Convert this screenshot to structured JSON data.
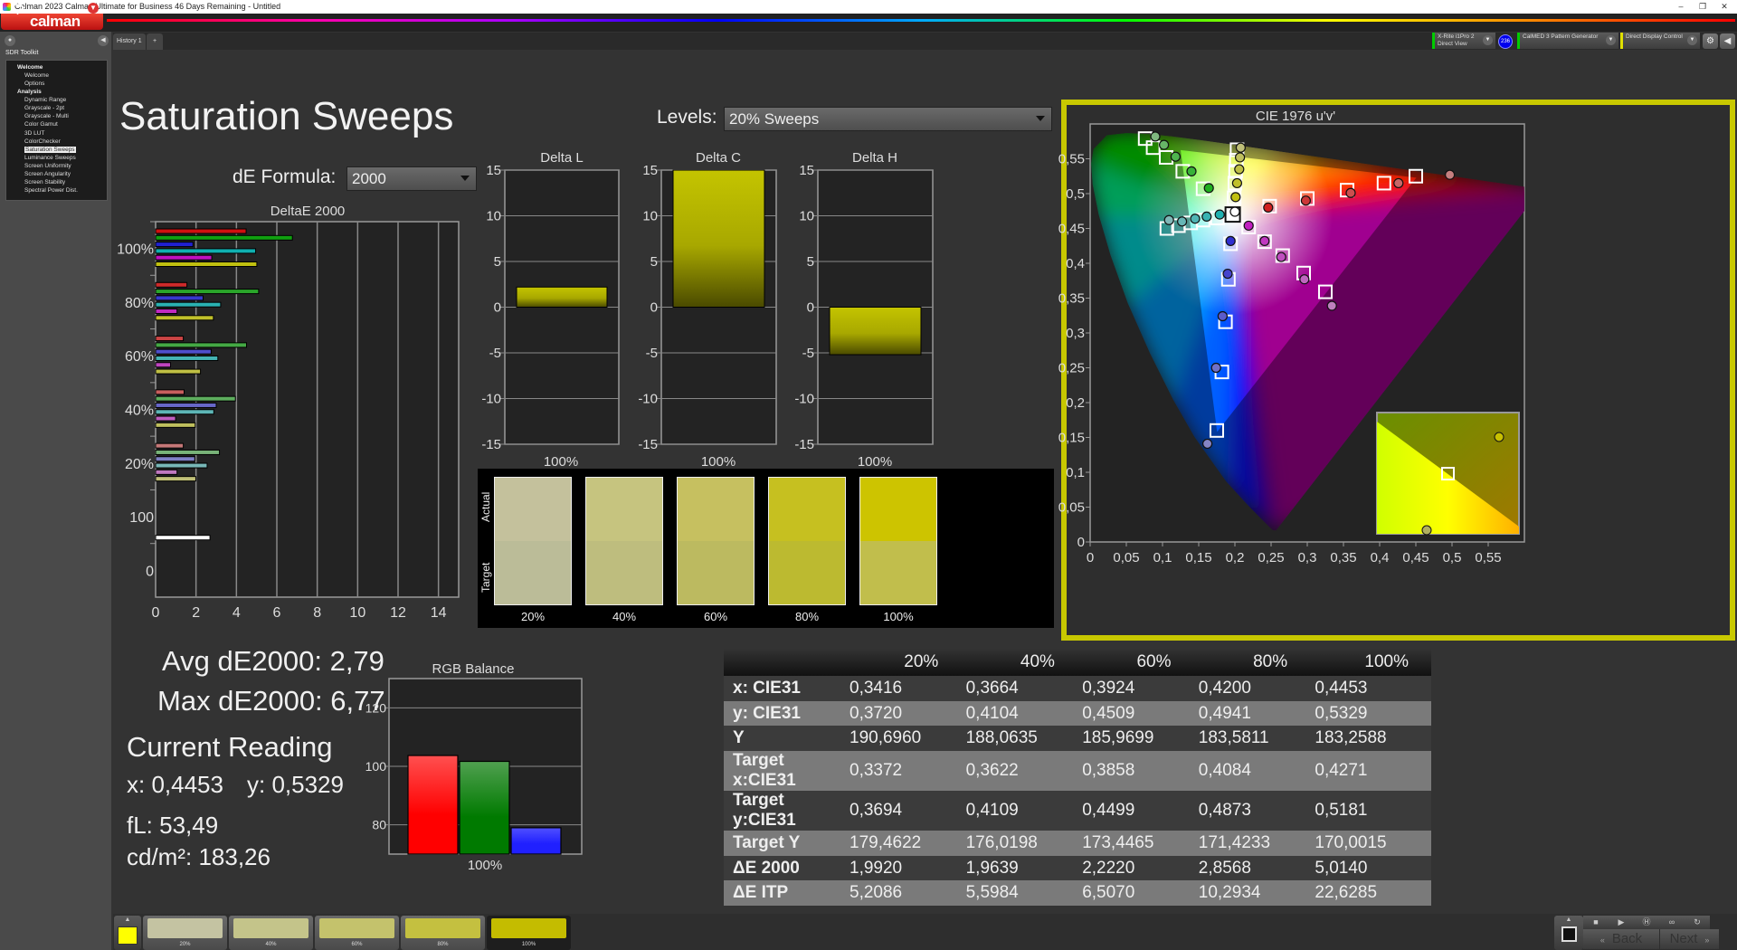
{
  "window": {
    "title": "Calman 2023 Calman Ultimate for Business 46 Days Remaining  - Untitled",
    "minimize": "–",
    "restore": "❐",
    "close": "✕"
  },
  "app": {
    "logo_text": "calman"
  },
  "sidebar": {
    "toolkit": "SDR Toolkit",
    "tree": [
      {
        "label": "Welcome",
        "children": [
          "Welcome",
          "Options"
        ]
      },
      {
        "label": "Analysis",
        "children": [
          "Dynamic Range",
          "Grayscale - 2pt",
          "Grayscale - Multi",
          "Color Gamut",
          "3D LUT",
          "ColorChecker",
          "Saturation Sweeps",
          "Luminance Sweeps",
          "Screen Uniformity",
          "Screen Angularity",
          "Screen Stability",
          "Spectral Power Dist."
        ]
      }
    ],
    "selected": "Saturation Sweeps"
  },
  "tabs": [
    {
      "label": "History 1"
    },
    {
      "label": "+"
    }
  ],
  "devices": {
    "meter": {
      "name": "X-Rite i1Pro 2",
      "mode": "Direct View",
      "status_color": "#00cc00"
    },
    "badge": "236",
    "pattern": {
      "name": "CalMED 3 Pattern Generator",
      "status_color": "#00cc00"
    },
    "display": {
      "name": "Direct Display Control",
      "status_color": "#e0e000"
    }
  },
  "page": {
    "title": "Saturation Sweeps",
    "levels_label": "Levels:",
    "levels_value": "20% Sweeps",
    "de_formula_label": "dE Formula:",
    "de_formula_value": "2000"
  },
  "stats": {
    "avg": "Avg dE2000: 2,79",
    "max": "Max dE2000: 6,77",
    "current_reading": "Current Reading",
    "x": "x: 0,4453",
    "y": "y: 0,5329",
    "fl": "fL: 53,49",
    "cdm2": "cd/m²: 183,26"
  },
  "swatches": {
    "actual_label": "Actual",
    "target_label": "Target",
    "items": [
      {
        "label": "20%",
        "actual": "#c4c19c",
        "target": "#bbbc98"
      },
      {
        "label": "40%",
        "actual": "#c6c47f",
        "target": "#bebd7e"
      },
      {
        "label": "60%",
        "actual": "#c6c060",
        "target": "#bcba60"
      },
      {
        "label": "80%",
        "actual": "#c6c020",
        "target": "#bcba30"
      },
      {
        "label": "100%",
        "actual": "#cdc400",
        "target": "#c1be4c"
      }
    ]
  },
  "table": {
    "columns": [
      "",
      "20%",
      "40%",
      "60%",
      "80%",
      "100%"
    ],
    "rows": [
      {
        "label": "x: CIE31",
        "values": [
          "0,3416",
          "0,3664",
          "0,3924",
          "0,4200",
          "0,4453"
        ]
      },
      {
        "label": "y: CIE31",
        "values": [
          "0,3720",
          "0,4104",
          "0,4509",
          "0,4941",
          "0,5329"
        ]
      },
      {
        "label": "Y",
        "values": [
          "190,6960",
          "188,0635",
          "185,9699",
          "183,5811",
          "183,2588"
        ]
      },
      {
        "label": "Target x:CIE31",
        "values": [
          "0,3372",
          "0,3622",
          "0,3858",
          "0,4084",
          "0,4271"
        ]
      },
      {
        "label": "Target y:CIE31",
        "values": [
          "0,3694",
          "0,4109",
          "0,4499",
          "0,4873",
          "0,5181"
        ]
      },
      {
        "label": "Target Y",
        "values": [
          "179,4622",
          "176,0198",
          "173,4465",
          "171,4233",
          "170,0015"
        ]
      },
      {
        "label": "ΔE 2000",
        "values": [
          "1,9920",
          "1,9639",
          "2,2220",
          "2,8568",
          "5,0140"
        ]
      },
      {
        "label": "ΔE ITP",
        "values": [
          "5,2086",
          "5,5984",
          "6,5070",
          "10,2934",
          "22,6285"
        ]
      }
    ]
  },
  "bottom": {
    "current_color": "#ffff00",
    "thumbs": [
      {
        "label": "20%",
        "color": "#c4c3a2"
      },
      {
        "label": "40%",
        "color": "#c4c48a"
      },
      {
        "label": "60%",
        "color": "#c4c26c"
      },
      {
        "label": "80%",
        "color": "#c4c040"
      },
      {
        "label": "100%",
        "color": "#c4bc00"
      }
    ],
    "selected": "100%",
    "back_label": "Back",
    "next_label": "Next"
  },
  "chart_data": [
    {
      "type": "bar",
      "orientation": "horizontal",
      "title": "DeltaE 2000",
      "categories": [
        "100%",
        "80%",
        "60%",
        "40%",
        "20%",
        "100",
        "0"
      ],
      "xlim": [
        0,
        15
      ],
      "xticks": [
        "0",
        "2",
        "4",
        "6",
        "8",
        "10",
        "12",
        "14"
      ],
      "grid": true,
      "series": [
        {
          "color": "#d01010",
          "values": [
            4.48,
            1.55,
            1.37,
            1.41,
            1.37,
            null,
            null
          ]
        },
        {
          "color": "#10a010",
          "values": [
            6.77,
            5.1,
            4.5,
            3.95,
            3.16,
            null,
            null
          ]
        },
        {
          "color": "#2020d0",
          "values": [
            1.85,
            2.35,
            2.75,
            3.0,
            1.94,
            null,
            null
          ]
        },
        {
          "color": "#10b0b0",
          "values": [
            4.95,
            3.22,
            3.08,
            2.88,
            2.55,
            null,
            null
          ]
        },
        {
          "color": "#c010c0",
          "values": [
            2.78,
            1.06,
            0.74,
            0.99,
            1.06,
            null,
            null
          ]
        },
        {
          "color": "#c0c010",
          "values": [
            5.01,
            2.86,
            2.22,
            1.96,
            1.99,
            null,
            null
          ]
        },
        {
          "color": "#ffffff",
          "values": [
            null,
            null,
            null,
            null,
            null,
            2.69,
            null
          ]
        }
      ]
    },
    {
      "type": "bar",
      "title": "Delta L",
      "categories": [
        "100%"
      ],
      "values": [
        2.2
      ],
      "ylim": [
        -15,
        15
      ],
      "yticks": [
        "15",
        "10",
        "5",
        "0",
        "-5",
        "-10",
        "-15"
      ],
      "color": "#c0c000"
    },
    {
      "type": "bar",
      "title": "Delta C",
      "categories": [
        "100%"
      ],
      "values": [
        15
      ],
      "ylim": [
        -15,
        15
      ],
      "yticks": [
        "15",
        "10",
        "5",
        "0",
        "-5",
        "-10",
        "-15"
      ],
      "color": "#c0c000"
    },
    {
      "type": "bar",
      "title": "Delta H",
      "categories": [
        "100%"
      ],
      "values": [
        -5.2
      ],
      "ylim": [
        -15,
        15
      ],
      "yticks": [
        "15",
        "10",
        "5",
        "0",
        "-5",
        "-10",
        "-15"
      ],
      "color": "#c0c000"
    },
    {
      "type": "bar",
      "title": "RGB Balance",
      "categories": [
        "100%"
      ],
      "ylim": [
        70,
        130
      ],
      "yticks": [
        "80",
        "100",
        "120"
      ],
      "series": [
        {
          "color": "#ff2020",
          "values": [
            103.7
          ]
        },
        {
          "color": "#109010",
          "values": [
            101.7
          ]
        },
        {
          "color": "#3030ff",
          "values": [
            79
          ]
        }
      ]
    },
    {
      "type": "scatter",
      "title": "CIE 1976 u'v'",
      "xlim": [
        0,
        0.6
      ],
      "ylim": [
        0,
        0.6
      ],
      "xticks": [
        "0",
        "0,05",
        "0,1",
        "0,15",
        "0,2",
        "0,25",
        "0,3",
        "0,35",
        "0,4",
        "0,45",
        "0,5",
        "0,55"
      ],
      "yticks": [
        "0",
        "0,05",
        "0,1",
        "0,15",
        "0,2",
        "0,25",
        "0,3",
        "0,35",
        "0,4",
        "0,45",
        "0,5",
        "0,55"
      ],
      "gamut_triangle": [
        [
          0.4507,
          0.5229
        ],
        [
          0.125,
          0.5625
        ],
        [
          0.1754,
          0.1579
        ]
      ],
      "white_target": [
        0.197,
        0.47
      ],
      "white_measured": [
        0.2,
        0.474
      ],
      "series": [
        {
          "color": "#d02020",
          "targets": [
            [
              0.45,
              0.525
            ],
            [
              0.406,
              0.515
            ],
            [
              0.355,
              0.505
            ],
            [
              0.3,
              0.493
            ],
            [
              0.248,
              0.482
            ]
          ],
          "measured": [
            [
              0.497,
              0.527
            ],
            [
              0.426,
              0.515
            ],
            [
              0.36,
              0.501
            ],
            [
              0.298,
              0.49
            ],
            [
              0.246,
              0.48
            ]
          ]
        },
        {
          "color": "#20b020",
          "targets": [
            [
              0.076,
              0.579
            ],
            [
              0.087,
              0.566
            ],
            [
              0.105,
              0.552
            ],
            [
              0.128,
              0.532
            ],
            [
              0.156,
              0.507
            ]
          ],
          "measured": [
            [
              0.09,
              0.582
            ],
            [
              0.102,
              0.57
            ],
            [
              0.118,
              0.553
            ],
            [
              0.14,
              0.532
            ],
            [
              0.164,
              0.508
            ]
          ]
        },
        {
          "color": "#3030d0",
          "targets": [
            [
              0.175,
              0.16
            ],
            [
              0.182,
              0.244
            ],
            [
              0.187,
              0.316
            ],
            [
              0.191,
              0.377
            ],
            [
              0.194,
              0.428
            ]
          ],
          "measured": [
            [
              0.162,
              0.141
            ],
            [
              0.174,
              0.25
            ],
            [
              0.183,
              0.324
            ],
            [
              0.19,
              0.385
            ],
            [
              0.194,
              0.432
            ]
          ]
        },
        {
          "color": "#20b0b0",
          "targets": [
            [
              0.106,
              0.45
            ],
            [
              0.122,
              0.454
            ],
            [
              0.139,
              0.458
            ],
            [
              0.156,
              0.462
            ],
            [
              0.176,
              0.465
            ]
          ],
          "measured": [
            [
              0.109,
              0.462
            ],
            [
              0.127,
              0.46
            ],
            [
              0.145,
              0.464
            ],
            [
              0.161,
              0.467
            ],
            [
              0.179,
              0.47
            ]
          ]
        },
        {
          "color": "#c020c0",
          "targets": [
            [
              0.325,
              0.359
            ],
            [
              0.295,
              0.386
            ],
            [
              0.266,
              0.411
            ],
            [
              0.241,
              0.431
            ],
            [
              0.219,
              0.452
            ]
          ],
          "measured": [
            [
              0.334,
              0.339
            ],
            [
              0.296,
              0.377
            ],
            [
              0.264,
              0.409
            ],
            [
              0.241,
              0.432
            ],
            [
              0.219,
              0.454
            ]
          ]
        },
        {
          "color": "#c0c010",
          "targets": [
            [
              0.203,
              0.563
            ],
            [
              0.202,
              0.548
            ],
            [
              0.201,
              0.532
            ],
            [
              0.2,
              0.515
            ],
            [
              0.199,
              0.494
            ]
          ],
          "measured": [
            [
              0.208,
              0.566
            ],
            [
              0.207,
              0.552
            ],
            [
              0.206,
              0.535
            ],
            [
              0.203,
              0.515
            ],
            [
              0.201,
              0.495
            ]
          ]
        }
      ]
    }
  ]
}
